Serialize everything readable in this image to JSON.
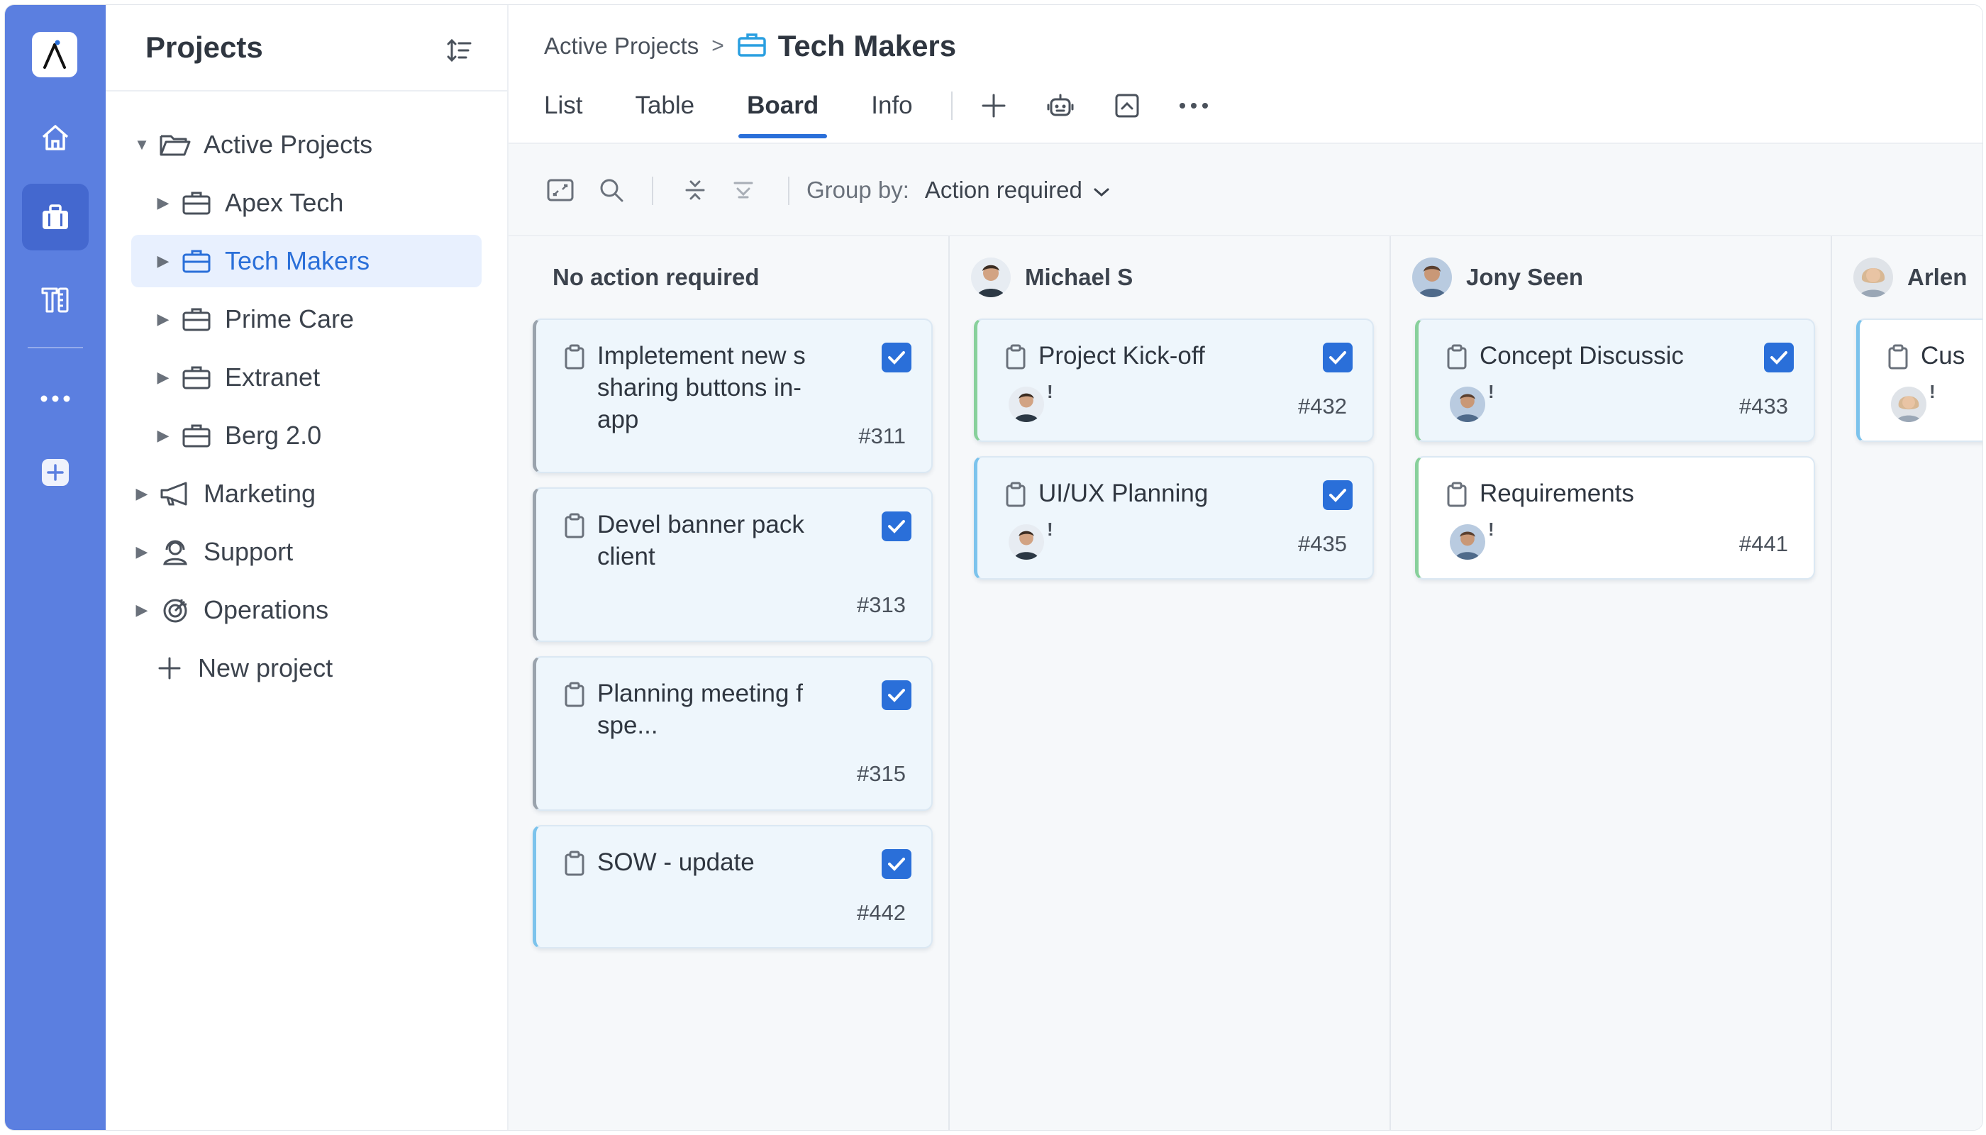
{
  "rail": {
    "items": [
      "home-icon",
      "briefcase-icon",
      "tools-icon",
      "more-icon",
      "add-icon"
    ]
  },
  "sidebar": {
    "title": "Projects",
    "tree": [
      {
        "label": "Active Projects",
        "icon": "folder-open-icon",
        "expanded": true
      },
      {
        "label": "Apex Tech",
        "icon": "briefcase-icon"
      },
      {
        "label": "Tech Makers",
        "icon": "briefcase-icon",
        "selected": true
      },
      {
        "label": "Prime Care",
        "icon": "briefcase-icon"
      },
      {
        "label": "Extranet",
        "icon": "briefcase-icon"
      },
      {
        "label": "Berg 2.0",
        "icon": "briefcase-icon"
      },
      {
        "label": "Marketing",
        "icon": "megaphone-icon"
      },
      {
        "label": "Support",
        "icon": "support-icon"
      },
      {
        "label": "Operations",
        "icon": "target-icon"
      },
      {
        "label": "New project",
        "icon": "plus-icon"
      }
    ]
  },
  "header": {
    "breadcrumb_parent": "Active Projects",
    "breadcrumb_separator": ">",
    "title": "Tech Makers",
    "tabs": [
      "List",
      "Table",
      "Board",
      "Info"
    ],
    "active_tab": "Board"
  },
  "toolbar": {
    "group_by_label": "Group by:",
    "group_by_value": "Action required"
  },
  "board": {
    "columns": [
      {
        "title": "No action required",
        "cards": [
          {
            "title": "Impletement new s sharing buttons in-app",
            "number": "#311"
          },
          {
            "title": "Devel banner pack client",
            "number": "#313"
          },
          {
            "title": "Planning meeting f spe...",
            "number": "#315"
          },
          {
            "title": "SOW - update",
            "number": "#442"
          }
        ]
      },
      {
        "title": "Michael S",
        "cards": [
          {
            "title": "Project Kick-off",
            "number": "#432",
            "flag": "!"
          },
          {
            "title": "UI/UX Planning",
            "number": "#435",
            "flag": "!"
          }
        ]
      },
      {
        "title": "Jony Seen",
        "cards": [
          {
            "title": "Concept Discussic",
            "number": "#433",
            "flag": "!"
          },
          {
            "title": "Requirements",
            "number": "#441",
            "flag": "!"
          }
        ]
      },
      {
        "title": "Arlen",
        "cards": [
          {
            "title": "Cus",
            "flag": "!"
          }
        ]
      }
    ]
  },
  "colors": {
    "rail": "#5b7fe0",
    "accent": "#2a6fd9",
    "selected_bg": "#e8f0fe",
    "card_bg": "#eef6fc"
  }
}
